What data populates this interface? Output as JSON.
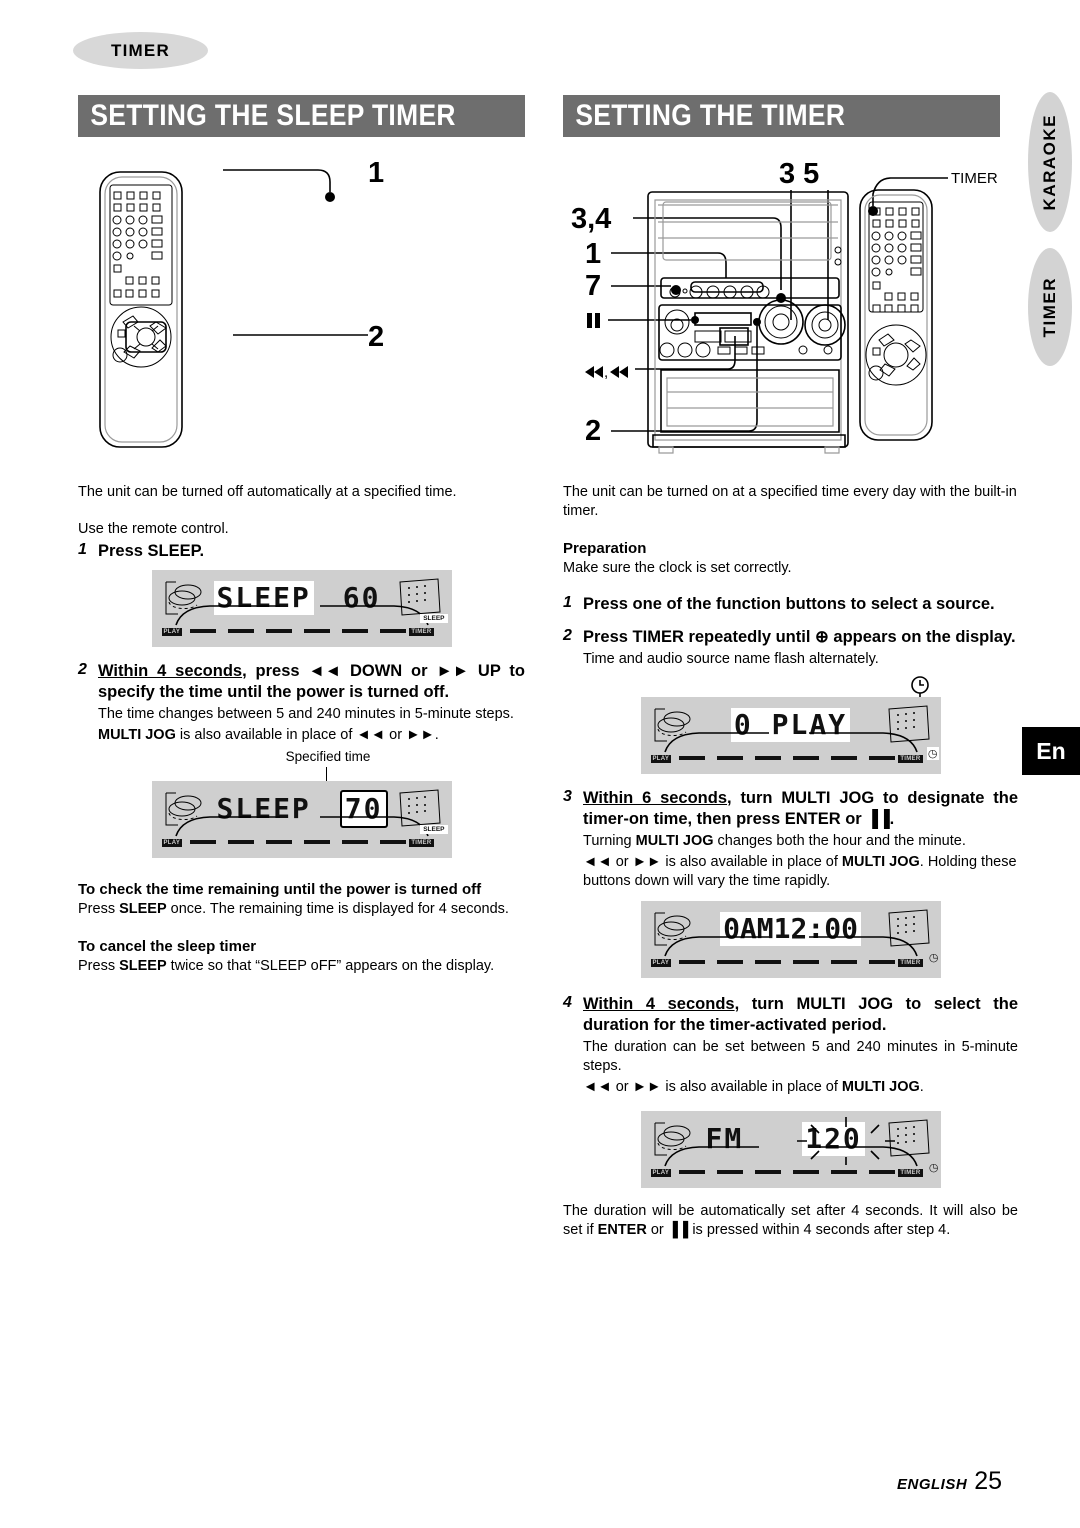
{
  "chapter_tab": "TIMER",
  "side_tabs": [
    {
      "label": "KARAOKE"
    },
    {
      "label": "TIMER"
    }
  ],
  "language_tab": "En",
  "sections": {
    "left": {
      "title": "SETTING THE SLEEP TIMER",
      "diagram": {
        "callouts": [
          {
            "label": "1"
          },
          {
            "label": "2"
          }
        ]
      },
      "intro": "The unit can be turned off automatically at a specified time.",
      "use_remote": "Use the remote control.",
      "step1": {
        "num": "1",
        "title": "Press SLEEP.",
        "display": {
          "text": "SLEEP 60",
          "seg_main": "SLEEP",
          "seg_value": "60",
          "left_label": "PLAY",
          "right_label": "TIMER",
          "badge": "SLEEP"
        }
      },
      "step2": {
        "num": "2",
        "title_part1": "Within 4 seconds",
        "title_part2": ", press ◄◄ DOWN or ►► UP to specify the time until the power is turned off.",
        "sub1": "The time changes between 5 and 240 minutes in 5-minute steps.",
        "sub2_bold": "MULTI JOG",
        "sub2_rest": " is also available in place of ◄◄ or ►►.",
        "caption": "Specified time",
        "display": {
          "seg_main": "SLEEP",
          "seg_value": "70",
          "left_label": "PLAY",
          "right_label": "TIMER",
          "badge": "SLEEP"
        }
      },
      "note1": {
        "heading": "To check the time remaining until the power is turned off",
        "body_a": "Press ",
        "body_b": "SLEEP",
        "body_c": " once. The remaining time is displayed for 4 seconds."
      },
      "note2": {
        "heading": "To cancel the sleep timer",
        "body_a": "Press ",
        "body_b": "SLEEP",
        "body_c": " twice so that “SLEEP oFF” appears on the display."
      }
    },
    "right": {
      "title": "SETTING THE TIMER",
      "diagram": {
        "callouts": [
          {
            "label": "3 5"
          },
          {
            "label": "3,4"
          },
          {
            "label": "1"
          },
          {
            "label": "7"
          },
          {
            "label": "▐▐"
          },
          {
            "label": "◄◄,►►"
          },
          {
            "label": "2"
          },
          {
            "label": "TIMER"
          }
        ]
      },
      "intro": "The unit can be turned on at a specified time every day with the built-in timer.",
      "preparation": {
        "heading": "Preparation",
        "body": "Make sure the clock is set correctly."
      },
      "step1": {
        "num": "1",
        "title": "Press one of the function buttons to select a source."
      },
      "step2": {
        "num": "2",
        "title": "Press TIMER repeatedly until ⊕ appears on the display.",
        "sub": "Time and audio source name flash alternately.",
        "callout_icon": "clock-icon",
        "display": {
          "seg_value": "0 PLAY",
          "left_label": "PLAY",
          "right_label": "TIMER",
          "badge": "clock"
        }
      },
      "step3": {
        "num": "3",
        "title_part1": "Within 6 seconds",
        "title_part2": ", turn MULTI JOG to designate the timer-on time, then press ENTER or ▐▐.",
        "sub1_a": "Turning ",
        "sub1_b": "MULTI JOG",
        "sub1_c": " changes both the hour and the minute.",
        "sub2_a": "◄◄ or ►► is also available in place of ",
        "sub2_b": "MULTI JOG",
        "sub2_c": ". Holding these buttons down will vary the time rapidly.",
        "display": {
          "seg_value": "0AM12:00",
          "left_label": "PLAY",
          "right_label": "TIMER"
        }
      },
      "step4": {
        "num": "4",
        "title_part1": "Within 4 seconds",
        "title_part2": ", turn MULTI JOG to select the duration for the timer-activated period.",
        "sub1": "The duration can be set between 5 and 240 minutes in 5-minute steps.",
        "sub2_a": "◄◄ or ►► is also available in place of ",
        "sub2_b": "MULTI JOG",
        "sub2_c": ".",
        "display": {
          "seg_main": "FM",
          "seg_value": "120",
          "left_label": "PLAY",
          "right_label": "TIMER"
        }
      },
      "closing": {
        "a": "The duration will be automatically set after 4 seconds. It will also be set if ",
        "b": "ENTER",
        "c": " or ▐▐ is pressed within 4 seconds after step 4."
      }
    }
  },
  "footer": {
    "language": "ENGLISH",
    "page": "25"
  }
}
